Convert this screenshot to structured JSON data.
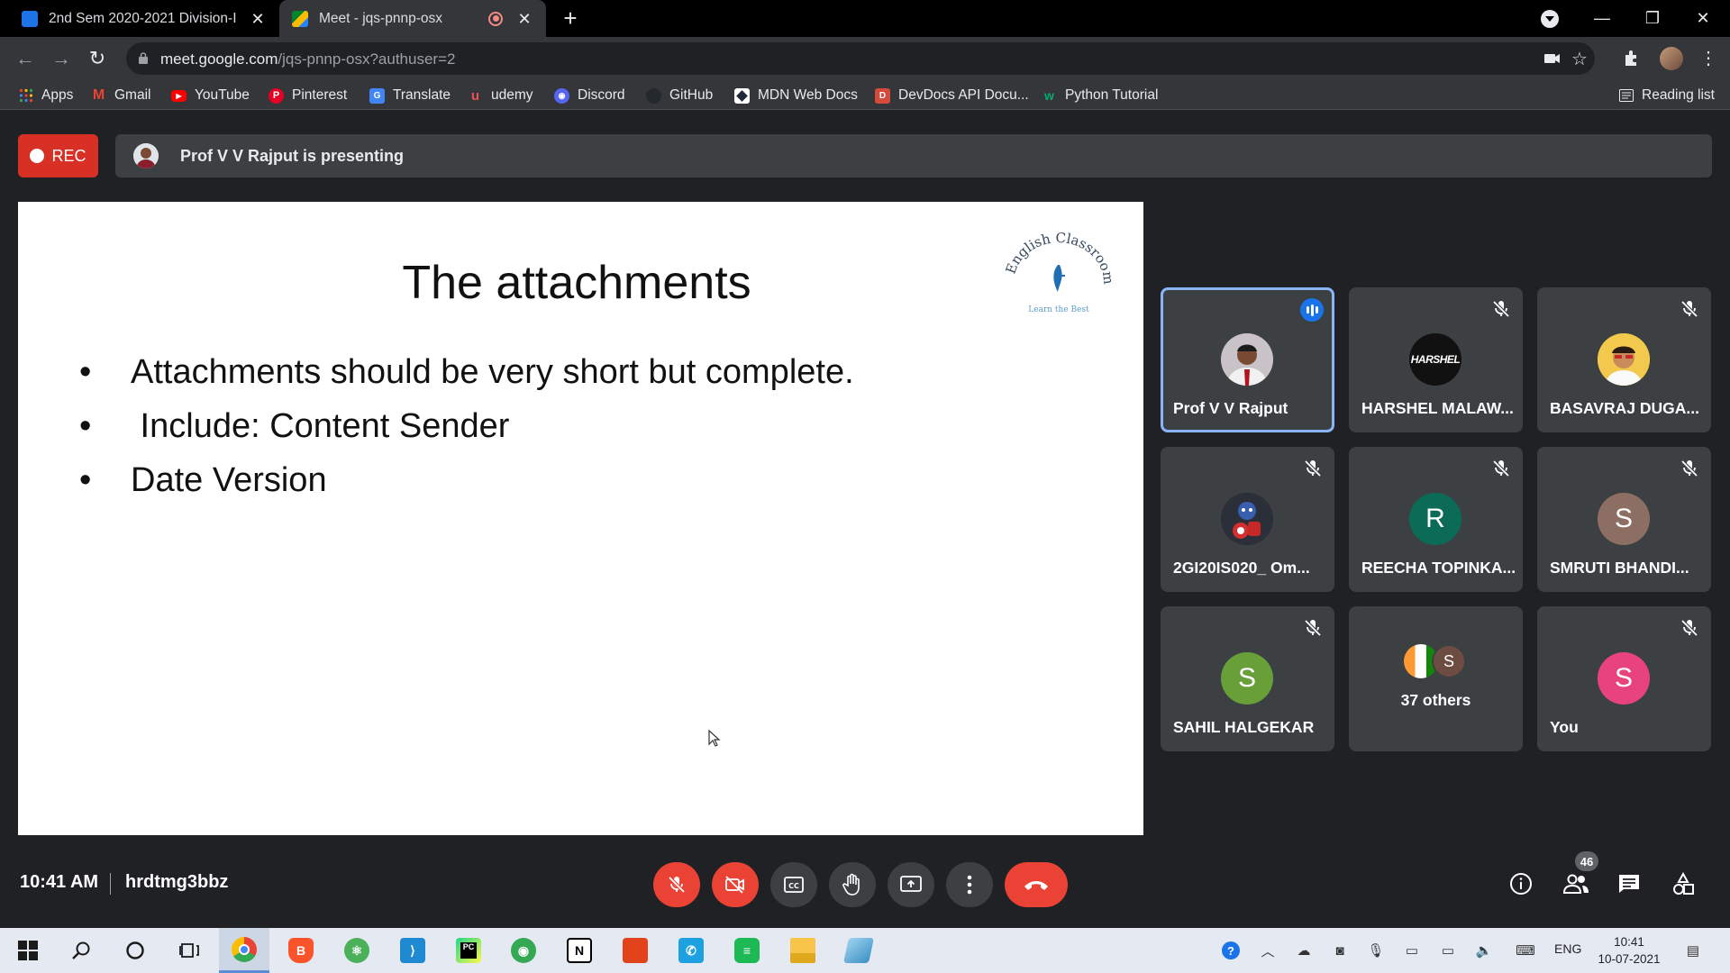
{
  "browser": {
    "tabs": [
      {
        "title": "2nd Sem 2020-2021 Division-I",
        "favicon": "classroom-icon",
        "active": false
      },
      {
        "title": "Meet - jqs-pnnp-osx",
        "favicon": "meet-icon",
        "active": true
      }
    ],
    "address": {
      "host": "meet.google.com",
      "path": "/jqs-pnnp-osx?authuser=2"
    },
    "bookmarks": [
      {
        "label": "Apps",
        "icon": "apps-grid-icon"
      },
      {
        "label": "Gmail",
        "icon": "gmail-icon"
      },
      {
        "label": "YouTube",
        "icon": "youtube-icon"
      },
      {
        "label": "Pinterest",
        "icon": "pinterest-icon"
      },
      {
        "label": "Translate",
        "icon": "translate-icon"
      },
      {
        "label": "udemy",
        "icon": "udemy-icon"
      },
      {
        "label": "Discord",
        "icon": "discord-icon"
      },
      {
        "label": "GitHub",
        "icon": "github-icon"
      },
      {
        "label": "MDN Web Docs",
        "icon": "mdn-icon"
      },
      {
        "label": "DevDocs API Docu...",
        "icon": "devdocs-icon"
      },
      {
        "label": "Python Tutorial",
        "icon": "w3schools-icon"
      }
    ],
    "reading_list": "Reading list"
  },
  "meet": {
    "rec_label": "REC",
    "presenting_text": "Prof V V Rajput is presenting",
    "slide": {
      "title": "The attachments",
      "bullets": [
        "Attachments should be very short but complete.",
        " Include: Content Sender",
        "Date Version"
      ]
    },
    "participants": [
      {
        "name": "Prof V V Rajput",
        "avatar": "photo",
        "speaking": true
      },
      {
        "name": "HARSHEL MALAW...",
        "avatar": "HARSHEL",
        "muted": true
      },
      {
        "name": "BASAVRAJ DUGA...",
        "avatar": "photo",
        "muted": true
      },
      {
        "name": "2GI20IS020_ Om...",
        "avatar": "photo",
        "muted": true
      },
      {
        "name": "REECHA TOPINKA...",
        "avatar": "R",
        "avatar_color": "#0b6b57",
        "muted": true
      },
      {
        "name": "SMRUTI BHANDI...",
        "avatar": "S",
        "avatar_color": "#8d6e63",
        "muted": true
      },
      {
        "name": "SAHIL HALGEKAR",
        "avatar": "S",
        "avatar_color": "#689f38",
        "muted": true
      },
      {
        "name": "37 others",
        "avatar": "S"
      },
      {
        "name": "You",
        "avatar": "S",
        "avatar_color": "#e8437c",
        "muted": true
      }
    ],
    "time": "10:41 AM",
    "meeting_code": "hrdtmg3bbz",
    "people_count": "46"
  },
  "taskbar": {
    "lang": "ENG",
    "time": "10:41",
    "date": "10-07-2021"
  }
}
